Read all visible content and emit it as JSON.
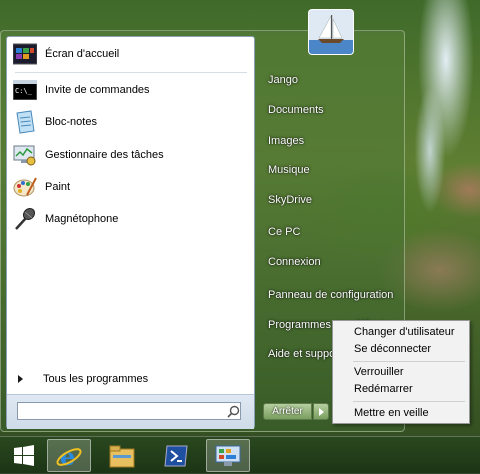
{
  "start_menu": {
    "programs": [
      {
        "label": "Écran d'accueil",
        "icon": "start-screen-icon"
      },
      {
        "label": "Invite de commandes",
        "icon": "command-prompt-icon"
      },
      {
        "label": "Bloc-notes",
        "icon": "notepad-icon"
      },
      {
        "label": "Gestionnaire des tâches",
        "icon": "task-manager-icon"
      },
      {
        "label": "Paint",
        "icon": "paint-icon"
      },
      {
        "label": "Magnétophone",
        "icon": "microphone-icon"
      }
    ],
    "all_programs_label": "Tous les programmes",
    "search_value": "",
    "right_items": [
      "Jango",
      "Documents",
      "Images",
      "Musique",
      "SkyDrive",
      "Ce PC",
      "Connexion",
      "Panneau de configuration",
      "Programmes par défaut",
      "Aide et support"
    ],
    "shutdown_label": "Arrêter"
  },
  "power_menu": {
    "items": [
      "Changer d'utilisateur",
      "Se déconnecter",
      "Verrouiller",
      "Redémarrer",
      "Mettre en veille"
    ]
  },
  "taskbar": {
    "items": [
      "windows-logo-icon",
      "internet-explorer-icon",
      "file-explorer-icon",
      "powershell-icon",
      "control-panel-icon"
    ]
  },
  "colors": {
    "accent": "#5a8a3c",
    "menu_bg": "#f2f2f2"
  }
}
